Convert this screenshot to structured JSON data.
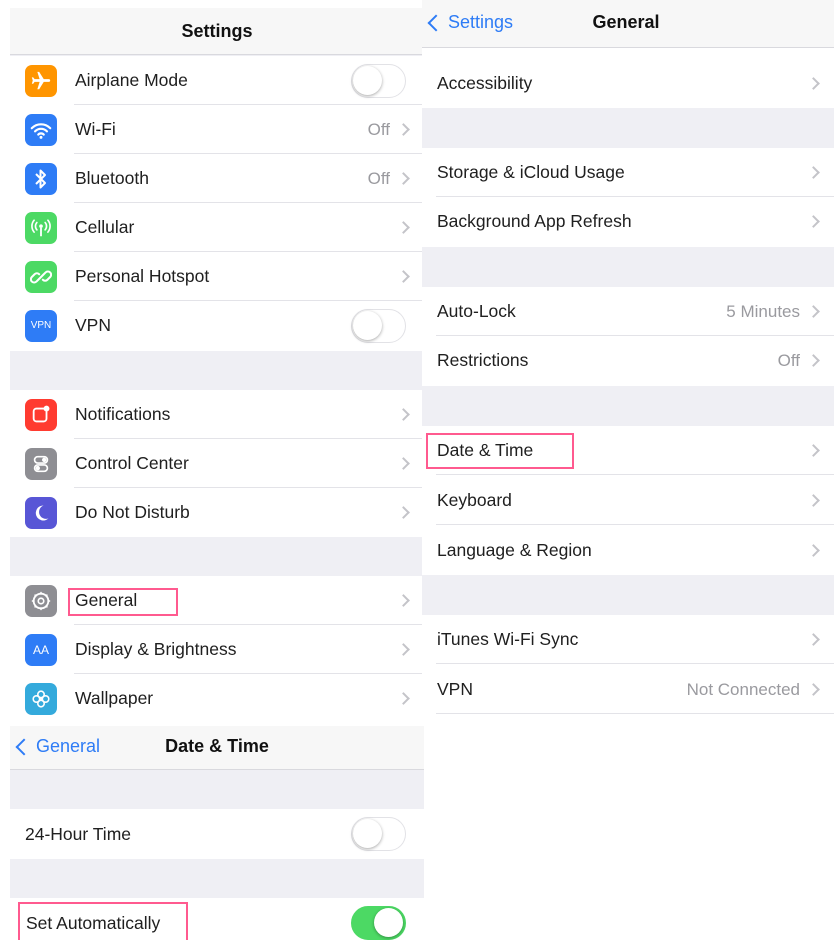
{
  "settings": {
    "title": "Settings",
    "items": [
      {
        "label": "Airplane Mode",
        "icon": "airplane-icon",
        "color": "#ff9500",
        "toggle": false
      },
      {
        "label": "Wi-Fi",
        "icon": "wifi-icon",
        "color": "#2e7cf6",
        "value": "Off"
      },
      {
        "label": "Bluetooth",
        "icon": "bluetooth-icon",
        "color": "#2e7cf6",
        "value": "Off"
      },
      {
        "label": "Cellular",
        "icon": "cellular-icon",
        "color": "#4cd964"
      },
      {
        "label": "Personal Hotspot",
        "icon": "hotspot-icon",
        "color": "#4cd964"
      },
      {
        "label": "VPN",
        "icon": "vpn-icon",
        "icon_text": "VPN",
        "color": "#2e7cf6",
        "toggle": false
      },
      {
        "label": "Notifications",
        "icon": "notifications-icon",
        "color": "#ff3b30"
      },
      {
        "label": "Control Center",
        "icon": "control-center-icon",
        "color": "#8e8e93"
      },
      {
        "label": "Do Not Disturb",
        "icon": "moon-icon",
        "color": "#5856d6"
      },
      {
        "label": "General",
        "icon": "gear-icon",
        "color": "#8e8e93"
      },
      {
        "label": "Display & Brightness",
        "icon": "display-brightness-icon",
        "icon_text": "AA",
        "color": "#2e7cf6"
      },
      {
        "label": "Wallpaper",
        "icon": "wallpaper-icon",
        "color": "#34aadc"
      }
    ]
  },
  "general": {
    "back_label": "Settings",
    "title": "General",
    "items": [
      {
        "label": "Accessibility"
      },
      {
        "label": "Storage & iCloud Usage"
      },
      {
        "label": "Background App Refresh"
      },
      {
        "label": "Auto-Lock",
        "value": "5 Minutes"
      },
      {
        "label": "Restrictions",
        "value": "Off"
      },
      {
        "label": "Date & Time"
      },
      {
        "label": "Keyboard"
      },
      {
        "label": "Language & Region"
      },
      {
        "label": "iTunes Wi-Fi Sync"
      },
      {
        "label": "VPN",
        "value": "Not Connected"
      }
    ]
  },
  "datetime": {
    "back_label": "General",
    "title": "Date & Time",
    "items": [
      {
        "label": "24-Hour Time",
        "toggle": false
      },
      {
        "label": "Set Automatically",
        "toggle": true
      }
    ]
  },
  "colors": {
    "accent": "#2e7cf6",
    "highlight": "#ff5a8f",
    "toggle_on": "#4cd964"
  }
}
